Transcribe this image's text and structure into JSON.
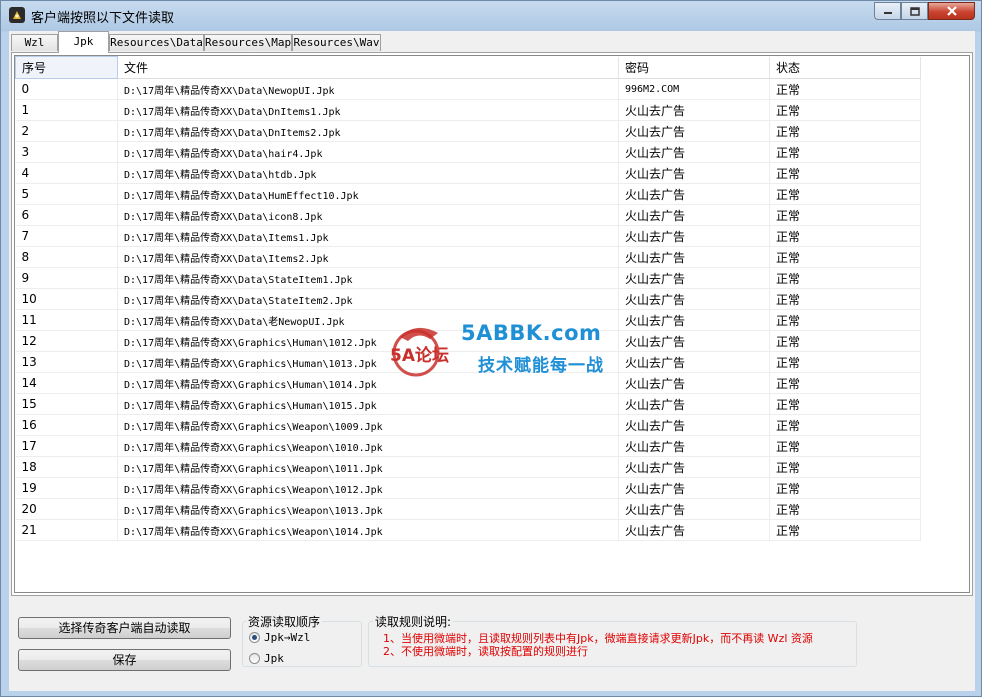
{
  "window": {
    "title": "客户端按照以下文件读取"
  },
  "tabs": [
    {
      "label": "Wzl"
    },
    {
      "label": "Jpk"
    },
    {
      "label": "Resources\\Data"
    },
    {
      "label": "Resources\\Map"
    },
    {
      "label": "Resources\\Wav"
    }
  ],
  "active_tab": "Jpk",
  "table": {
    "columns": [
      "序号",
      "文件",
      "密码",
      "状态"
    ],
    "rows": [
      {
        "no": "0",
        "file": "D:\\17周年\\精品传奇XX\\Data\\NewopUI.Jpk",
        "pw": "996M2.COM",
        "status": "正常"
      },
      {
        "no": "1",
        "file": "D:\\17周年\\精品传奇XX\\Data\\DnItems1.Jpk",
        "pw": "火山去广告",
        "status": "正常"
      },
      {
        "no": "2",
        "file": "D:\\17周年\\精品传奇XX\\Data\\DnItems2.Jpk",
        "pw": "火山去广告",
        "status": "正常"
      },
      {
        "no": "3",
        "file": "D:\\17周年\\精品传奇XX\\Data\\hair4.Jpk",
        "pw": "火山去广告",
        "status": "正常"
      },
      {
        "no": "4",
        "file": "D:\\17周年\\精品传奇XX\\Data\\htdb.Jpk",
        "pw": "火山去广告",
        "status": "正常"
      },
      {
        "no": "5",
        "file": "D:\\17周年\\精品传奇XX\\Data\\HumEffect10.Jpk",
        "pw": "火山去广告",
        "status": "正常"
      },
      {
        "no": "6",
        "file": "D:\\17周年\\精品传奇XX\\Data\\icon8.Jpk",
        "pw": "火山去广告",
        "status": "正常"
      },
      {
        "no": "7",
        "file": "D:\\17周年\\精品传奇XX\\Data\\Items1.Jpk",
        "pw": "火山去广告",
        "status": "正常"
      },
      {
        "no": "8",
        "file": "D:\\17周年\\精品传奇XX\\Data\\Items2.Jpk",
        "pw": "火山去广告",
        "status": "正常"
      },
      {
        "no": "9",
        "file": "D:\\17周年\\精品传奇XX\\Data\\StateItem1.Jpk",
        "pw": "火山去广告",
        "status": "正常"
      },
      {
        "no": "10",
        "file": "D:\\17周年\\精品传奇XX\\Data\\StateItem2.Jpk",
        "pw": "火山去广告",
        "status": "正常"
      },
      {
        "no": "11",
        "file": "D:\\17周年\\精品传奇XX\\Data\\老NewopUI.Jpk",
        "pw": "火山去广告",
        "status": "正常"
      },
      {
        "no": "12",
        "file": "D:\\17周年\\精品传奇XX\\Graphics\\Human\\1012.Jpk",
        "pw": "火山去广告",
        "status": "正常"
      },
      {
        "no": "13",
        "file": "D:\\17周年\\精品传奇XX\\Graphics\\Human\\1013.Jpk",
        "pw": "火山去广告",
        "status": "正常"
      },
      {
        "no": "14",
        "file": "D:\\17周年\\精品传奇XX\\Graphics\\Human\\1014.Jpk",
        "pw": "火山去广告",
        "status": "正常"
      },
      {
        "no": "15",
        "file": "D:\\17周年\\精品传奇XX\\Graphics\\Human\\1015.Jpk",
        "pw": "火山去广告",
        "status": "正常"
      },
      {
        "no": "16",
        "file": "D:\\17周年\\精品传奇XX\\Graphics\\Weapon\\1009.Jpk",
        "pw": "火山去广告",
        "status": "正常"
      },
      {
        "no": "17",
        "file": "D:\\17周年\\精品传奇XX\\Graphics\\Weapon\\1010.Jpk",
        "pw": "火山去广告",
        "status": "正常"
      },
      {
        "no": "18",
        "file": "D:\\17周年\\精品传奇XX\\Graphics\\Weapon\\1011.Jpk",
        "pw": "火山去广告",
        "status": "正常"
      },
      {
        "no": "19",
        "file": "D:\\17周年\\精品传奇XX\\Graphics\\Weapon\\1012.Jpk",
        "pw": "火山去广告",
        "status": "正常"
      },
      {
        "no": "20",
        "file": "D:\\17周年\\精品传奇XX\\Graphics\\Weapon\\1013.Jpk",
        "pw": "火山去广告",
        "status": "正常"
      },
      {
        "no": "21",
        "file": "D:\\17周年\\精品传奇XX\\Graphics\\Weapon\\1014.Jpk",
        "pw": "火山去广告",
        "status": "正常"
      }
    ]
  },
  "buttons": {
    "auto_read": "选择传奇客户端自动读取",
    "save": "保存"
  },
  "read_order": {
    "label": "资源读取顺序",
    "options": [
      "Jpk→Wzl",
      "Jpk"
    ],
    "selected": "Jpk→Wzl"
  },
  "rules": {
    "label": "读取规则说明:",
    "lines": [
      "1、当使用微端时，且读取规则列表中有Jpk，微端直接请求更新Jpk，而不再读 Wzl 资源",
      "2、不使用微端时，读取按配置的规则进行"
    ]
  },
  "watermark": {
    "logo_text": "5A论坛",
    "site": "5ABBK.com",
    "slogan": "技术赋能每一战"
  },
  "colors": {
    "rule_text": "#e00000",
    "watermark": "#1f8fd6",
    "titlebar": "#b9d1ea"
  },
  "icons": [
    "app-icon",
    "minimize-icon",
    "maximize-icon",
    "close-icon",
    "radio-icon"
  ]
}
